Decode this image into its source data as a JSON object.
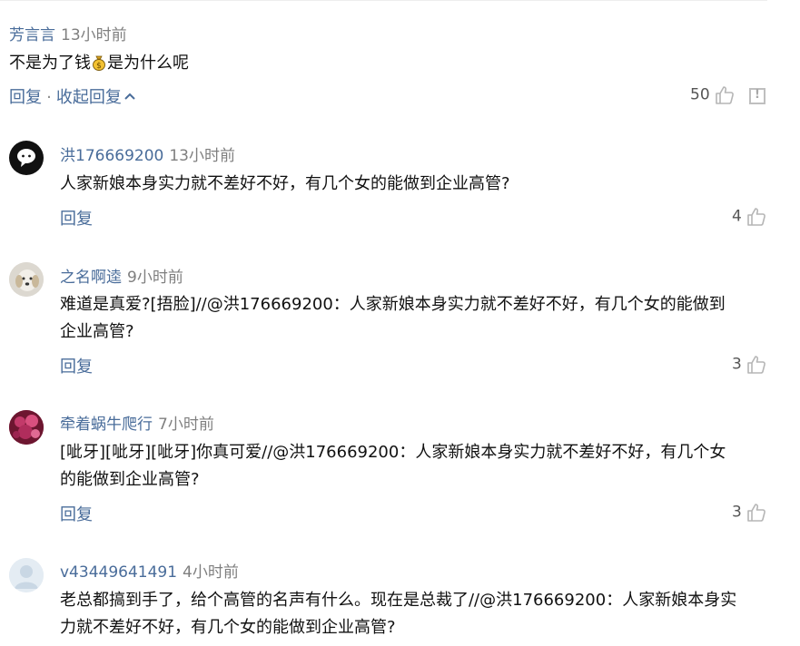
{
  "main": {
    "user": "芳言言",
    "time": "13小时前",
    "text_before": "不是为了钱",
    "text_after": "是为什么呢",
    "reply_label": "回复",
    "separator": "·",
    "collapse_label": "收起回复",
    "likes": "50"
  },
  "replies": [
    {
      "user": "洪176669200",
      "time": "13小时前",
      "text": "人家新娘本身实力就不差好不好，有几个女的能做到企业高管?",
      "reply_label": "回复",
      "likes": "4"
    },
    {
      "user": "之名啊逵",
      "time": "9小时前",
      "text_line1": "难道是真爱?[捂脸]//@洪176669200：人家新娘本身实力就不差好不好，有几个女的能做到",
      "text_line2": "企业高管?",
      "reply_label": "回复",
      "likes": "3"
    },
    {
      "user": "牵着蜗牛爬行",
      "time": "7小时前",
      "text_line1": "[呲牙][呲牙][呲牙]你真可爱//@洪176669200：人家新娘本身实力就不差好不好，有几个女",
      "text_line2": "的能做到企业高管?",
      "reply_label": "回复",
      "likes": "3"
    },
    {
      "user": "v43449641491",
      "time": "4小时前",
      "text_line1": "老总都搞到手了，给个高管的名声有什么。现在是总裁了//@洪176669200：人家新娘本身实",
      "text_line2": "力就不差好不好，有几个女的能做到企业高管?"
    }
  ],
  "icons": {
    "money": "money-bag-icon",
    "like": "thumbs-up-icon",
    "report": "report-icon",
    "collapse": "chevron-up-icon"
  },
  "colors": {
    "name": "#496c9a",
    "time": "#7f7f7f",
    "icon": "#b5b5b5"
  }
}
